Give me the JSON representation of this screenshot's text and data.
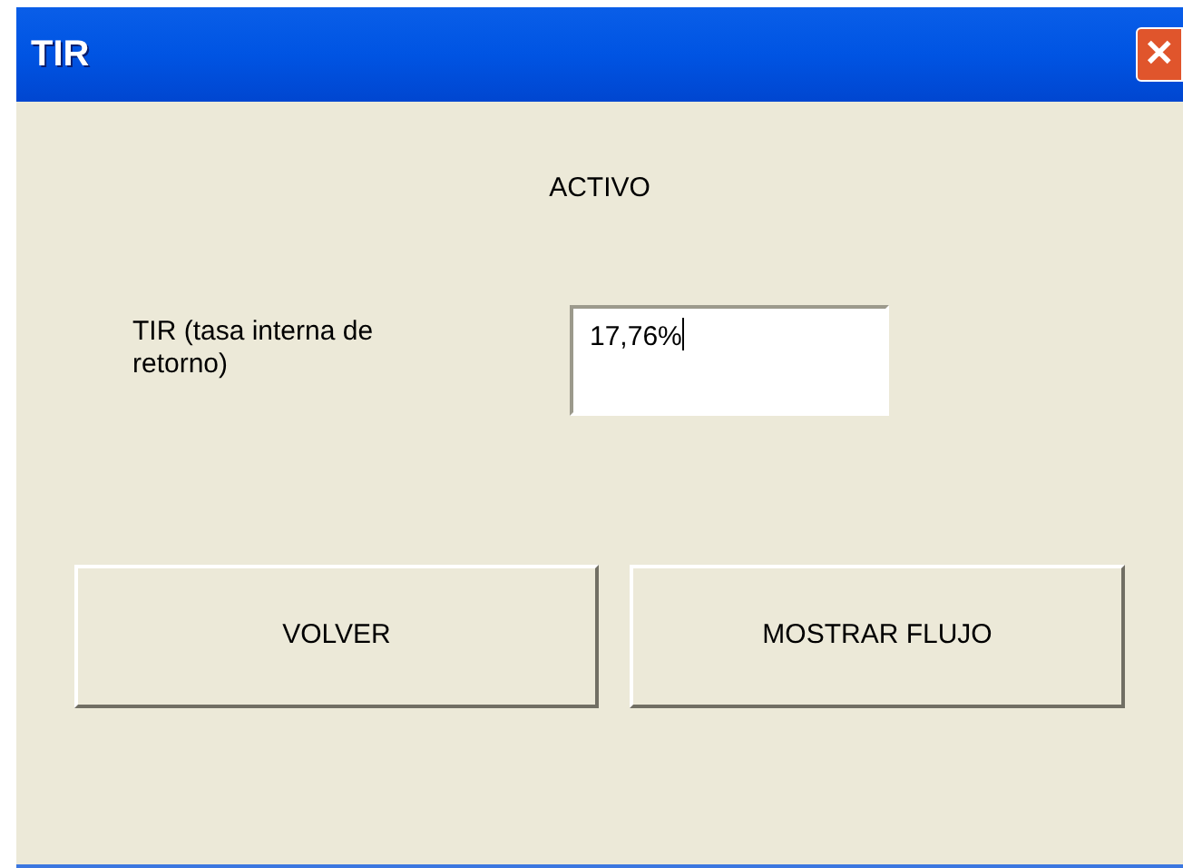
{
  "window": {
    "title": "TIR",
    "close_button": "✕"
  },
  "heading": "ACTIVO",
  "field": {
    "label": "TIR (tasa interna de retorno)",
    "value": "17,76%",
    "focused": true
  },
  "buttons": [
    {
      "label": "VOLVER"
    },
    {
      "label": "MOSTRAR FLUJO"
    }
  ]
}
